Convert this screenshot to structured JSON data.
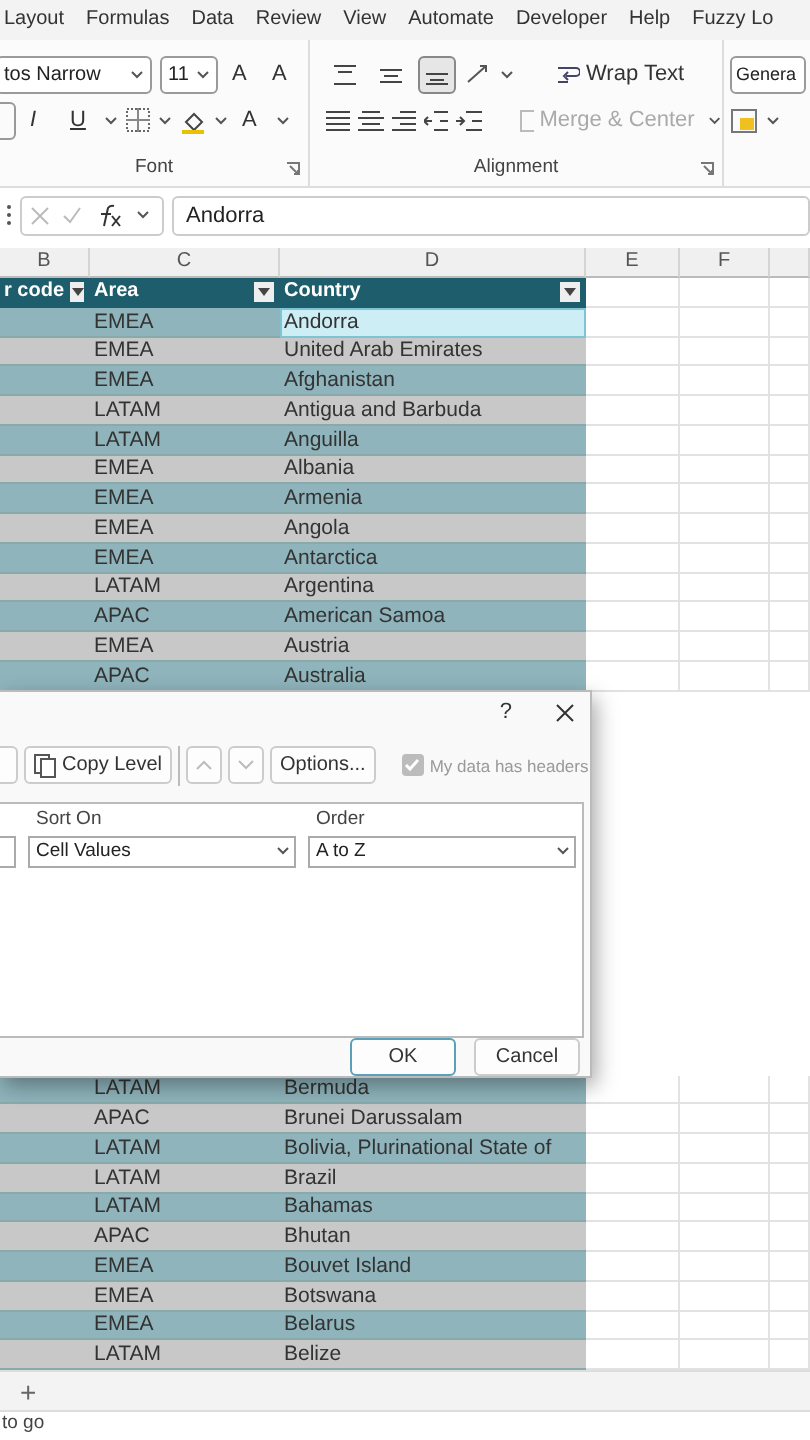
{
  "ribbon_tabs": [
    "Layout",
    "Formulas",
    "Data",
    "Review",
    "View",
    "Automate",
    "Developer",
    "Help",
    "Fuzzy Lo"
  ],
  "font_group": {
    "font_name": "tos Narrow",
    "font_size": "11",
    "grow": "A",
    "shrink": "A",
    "italic": "I",
    "underline": "U",
    "font_color": "A",
    "label": "Font"
  },
  "alignment_group": {
    "vertical": [
      {
        "selected": false
      },
      {
        "selected": false
      },
      {
        "selected": true
      }
    ],
    "wrap_text": "Wrap Text",
    "merge": {
      "label": "Merge & Center",
      "disabled": true
    },
    "label": "Alignment"
  },
  "number_group": {
    "format": "Genera"
  },
  "formula_bar": {
    "value": "Andorra"
  },
  "columns": [
    "B",
    "C",
    "D",
    "E",
    "F"
  ],
  "table": {
    "headers": [
      "r code",
      "Area",
      "Country"
    ],
    "rows_top": [
      {
        "area": "EMEA",
        "country": "Andorra",
        "selected": true
      },
      {
        "area": "EMEA",
        "country": "United Arab Emirates",
        "selected": false
      },
      {
        "area": "EMEA",
        "country": "Afghanistan",
        "selected": false
      },
      {
        "area": "LATAM",
        "country": "Antigua and Barbuda",
        "selected": false
      },
      {
        "area": "LATAM",
        "country": "Anguilla",
        "selected": false
      },
      {
        "area": "EMEA",
        "country": "Albania",
        "selected": false
      },
      {
        "area": "EMEA",
        "country": "Armenia",
        "selected": false
      },
      {
        "area": "EMEA",
        "country": "Angola",
        "selected": false
      },
      {
        "area": "EMEA",
        "country": "Antarctica",
        "selected": false
      },
      {
        "area": "LATAM",
        "country": "Argentina",
        "selected": false
      },
      {
        "area": "APAC",
        "country": "American Samoa",
        "selected": false
      },
      {
        "area": "EMEA",
        "country": "Austria",
        "selected": false
      },
      {
        "area": "APAC",
        "country": "Australia",
        "selected": false
      }
    ],
    "rows_bottom": [
      {
        "area": "LATAM",
        "country": "Bermuda",
        "selected": false
      },
      {
        "area": "APAC",
        "country": "Brunei Darussalam",
        "selected": false
      },
      {
        "area": "LATAM",
        "country": "Bolivia, Plurinational State of",
        "selected": false
      },
      {
        "area": "LATAM",
        "country": "Brazil",
        "selected": false
      },
      {
        "area": "LATAM",
        "country": "Bahamas",
        "selected": false
      },
      {
        "area": "APAC",
        "country": "Bhutan",
        "selected": false
      },
      {
        "area": "EMEA",
        "country": "Bouvet Island",
        "selected": false
      },
      {
        "area": "EMEA",
        "country": "Botswana",
        "selected": false
      },
      {
        "area": "EMEA",
        "country": "Belarus",
        "selected": false
      },
      {
        "area": "LATAM",
        "country": "Belize",
        "selected": false
      }
    ]
  },
  "dialog": {
    "help": "?",
    "copy_level": "Copy Level",
    "options": "Options...",
    "headers_checkbox": {
      "label": "My data has headers",
      "checked": true,
      "disabled": true
    },
    "list_headers": [
      "Sort On",
      "Order"
    ],
    "sort_on": "Cell Values",
    "order": "A to Z",
    "ok": "OK",
    "cancel": "Cancel"
  },
  "sheet_tabs": {
    "add": "+"
  },
  "status_bar": "to go"
}
